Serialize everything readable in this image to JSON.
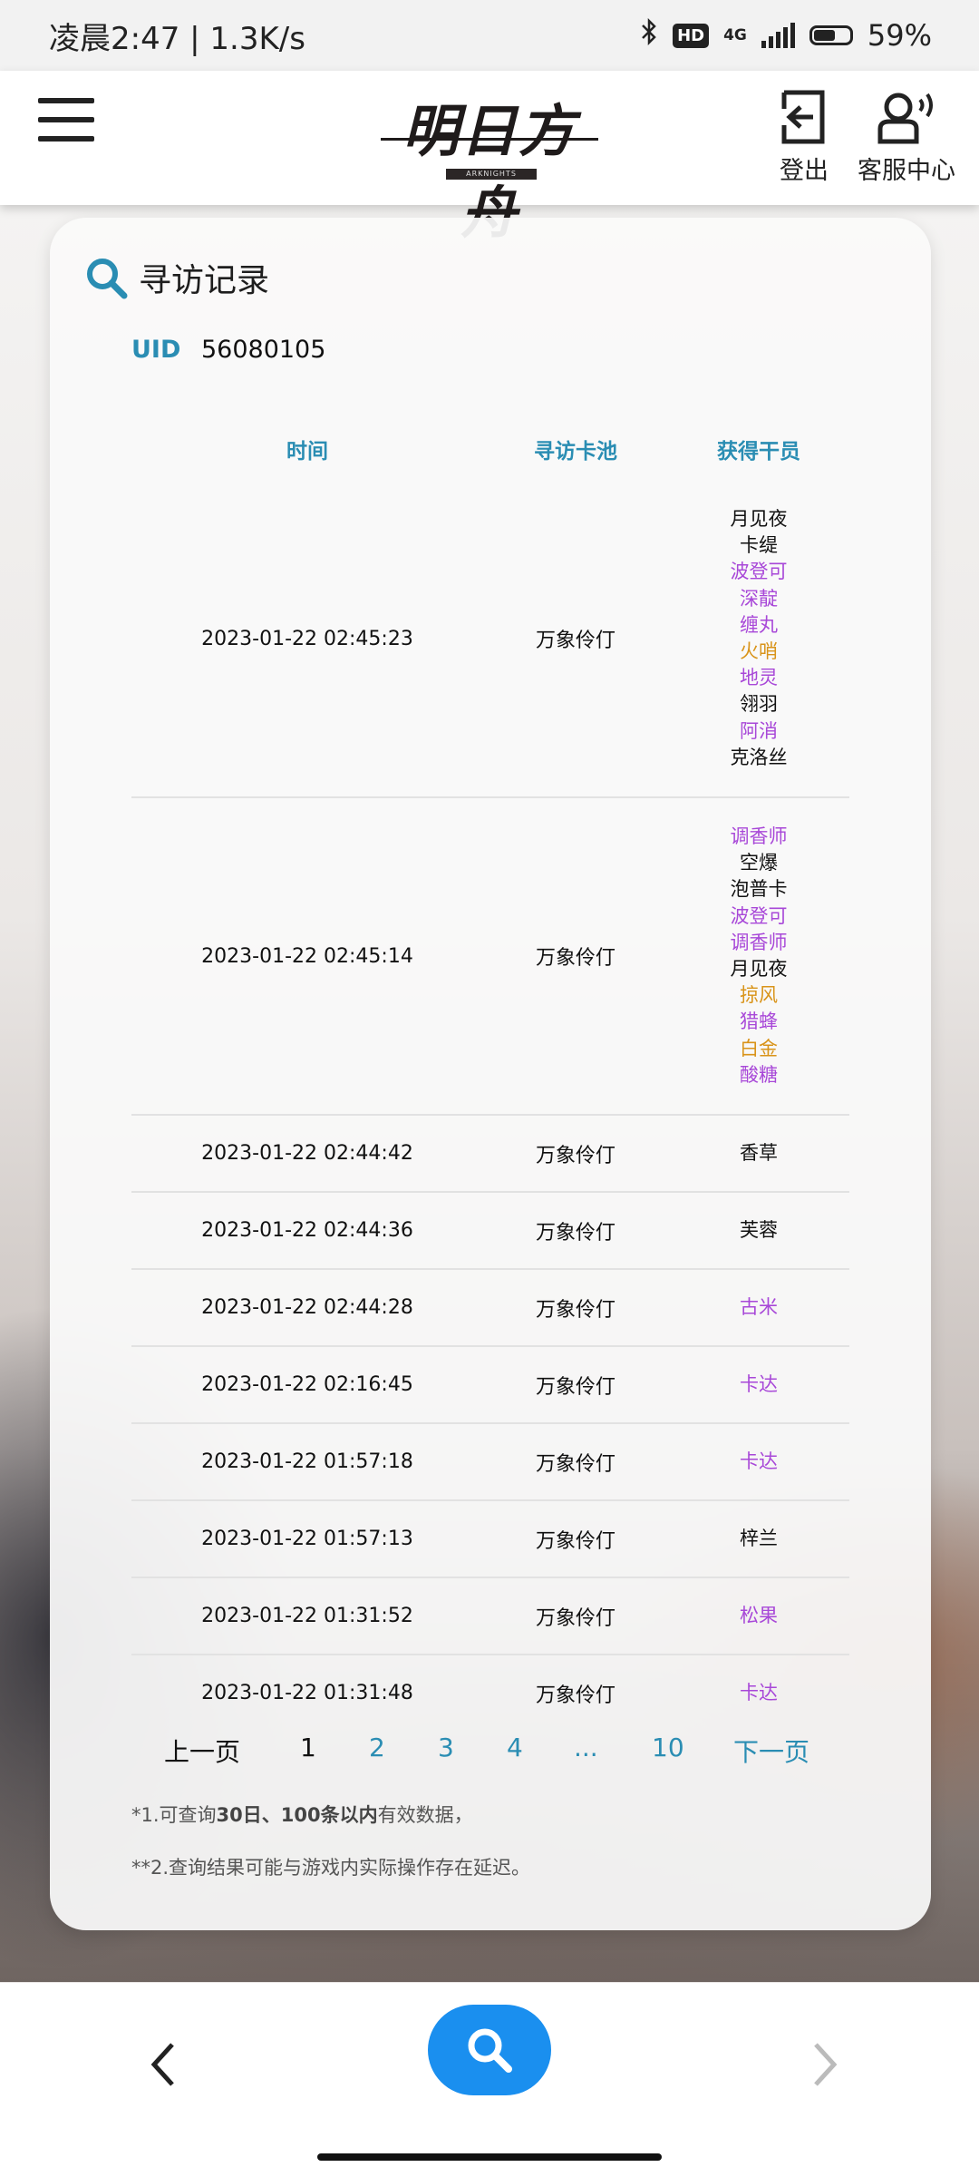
{
  "status_bar": {
    "time_speed": "凌晨2:47 | 1.3K/s",
    "hd_badge": "HD",
    "network": "4G",
    "battery": "59%"
  },
  "header": {
    "logo_text": "明日方舟",
    "logo_sub": "ARKNIGHTS",
    "logout_label": "登出",
    "service_label": "客服中心"
  },
  "card": {
    "title": "寻访记录",
    "uid_label": "UID",
    "uid_value": "56080105"
  },
  "table": {
    "headers": {
      "time": "时间",
      "pool": "寻访卡池",
      "operators": "获得干员"
    },
    "rows": [
      {
        "time": "2023-01-22 02:45:23",
        "pool": "万象伶仃",
        "operators": [
          {
            "name": "月见夜",
            "color": "#111111"
          },
          {
            "name": "卡缇",
            "color": "#111111"
          },
          {
            "name": "波登可",
            "color": "#a848d8"
          },
          {
            "name": "深靛",
            "color": "#a848d8"
          },
          {
            "name": "缠丸",
            "color": "#a848d8"
          },
          {
            "name": "火哨",
            "color": "#d9941a"
          },
          {
            "name": "地灵",
            "color": "#a848d8"
          },
          {
            "name": "翎羽",
            "color": "#111111"
          },
          {
            "name": "阿消",
            "color": "#a848d8"
          },
          {
            "name": "克洛丝",
            "color": "#111111"
          }
        ]
      },
      {
        "time": "2023-01-22 02:45:14",
        "pool": "万象伶仃",
        "operators": [
          {
            "name": "调香师",
            "color": "#a848d8"
          },
          {
            "name": "空爆",
            "color": "#111111"
          },
          {
            "name": "泡普卡",
            "color": "#111111"
          },
          {
            "name": "波登可",
            "color": "#a848d8"
          },
          {
            "name": "调香师",
            "color": "#a848d8"
          },
          {
            "name": "月见夜",
            "color": "#111111"
          },
          {
            "name": "掠风",
            "color": "#d9941a"
          },
          {
            "name": "猎蜂",
            "color": "#a848d8"
          },
          {
            "name": "白金",
            "color": "#d9941a"
          },
          {
            "name": "酸糖",
            "color": "#a848d8"
          }
        ]
      },
      {
        "time": "2023-01-22 02:44:42",
        "pool": "万象伶仃",
        "operators": [
          {
            "name": "香草",
            "color": "#111111"
          }
        ]
      },
      {
        "time": "2023-01-22 02:44:36",
        "pool": "万象伶仃",
        "operators": [
          {
            "name": "芙蓉",
            "color": "#111111"
          }
        ]
      },
      {
        "time": "2023-01-22 02:44:28",
        "pool": "万象伶仃",
        "operators": [
          {
            "name": "古米",
            "color": "#a848d8"
          }
        ]
      },
      {
        "time": "2023-01-22 02:16:45",
        "pool": "万象伶仃",
        "operators": [
          {
            "name": "卡达",
            "color": "#a848d8"
          }
        ]
      },
      {
        "time": "2023-01-22 01:57:18",
        "pool": "万象伶仃",
        "operators": [
          {
            "name": "卡达",
            "color": "#a848d8"
          }
        ]
      },
      {
        "time": "2023-01-22 01:57:13",
        "pool": "万象伶仃",
        "operators": [
          {
            "name": "梓兰",
            "color": "#111111"
          }
        ]
      },
      {
        "time": "2023-01-22 01:31:52",
        "pool": "万象伶仃",
        "operators": [
          {
            "name": "松果",
            "color": "#a848d8"
          }
        ]
      },
      {
        "time": "2023-01-22 01:31:48",
        "pool": "万象伶仃",
        "operators": [
          {
            "name": "卡达",
            "color": "#a848d8"
          }
        ]
      }
    ]
  },
  "pagination": {
    "prev": "上一页",
    "current": "1",
    "pages": [
      "2",
      "3",
      "4",
      "...",
      "10"
    ],
    "next": "下一页"
  },
  "notes": {
    "note1_prefix": "*1.可查询",
    "note1_bold": "30日、100条以内",
    "note1_suffix": "有效数据，",
    "note2": "**2.查询结果可能与游戏内实际操作存在延迟。"
  },
  "colors": {
    "accent": "#2a8db3",
    "search_button": "#1a8fef",
    "rarity_5": "#d9941a",
    "rarity_4": "#a848d8",
    "rarity_3": "#111111"
  }
}
